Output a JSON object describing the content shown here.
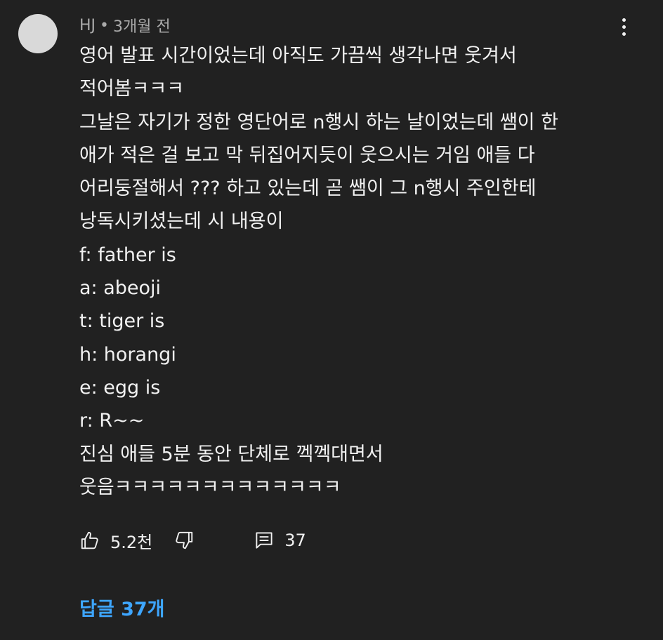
{
  "comment": {
    "author": "HJ",
    "separator": "•",
    "time": "3개월 전",
    "lines": [
      "영어 발표 시간이었는데 아직도 가끔씩 생각나면 웃겨서",
      "적어봄ㅋㅋㅋ",
      "그날은 자기가 정한 영단어로 n행시 하는 날이었는데 쌤이 한",
      "애가 적은 걸 보고 막 뒤집어지듯이 웃으시는 거임 애들 다",
      "어리둥절해서 ??? 하고 있는데 곧 쌤이 그 n행시 주인한테",
      "낭독시키셨는데 시 내용이",
      "f: father is",
      "a: abeoji",
      "t: tiger is",
      "h: horangi",
      "e: egg is",
      "r: R~~",
      "진심 애들 5분 동안 단체로 껙껙대면서",
      "웃음ㅋㅋㅋㅋㅋㅋㅋㅋㅋㅋㅋㅋㅋ"
    ]
  },
  "actions": {
    "like_icon": "thumbs-up-icon",
    "like_count": "5.2천",
    "dislike_icon": "thumbs-down-icon",
    "reply_icon": "comment-icon",
    "reply_count": "37"
  },
  "replies": {
    "label": "답글 37개"
  },
  "menu_icon": "more-vertical-icon",
  "colors": {
    "background": "#212121",
    "text": "#f1f1f1",
    "meta_text": "#aaaaaa",
    "link": "#3ea6ff",
    "avatar": "#d9d9d9"
  }
}
